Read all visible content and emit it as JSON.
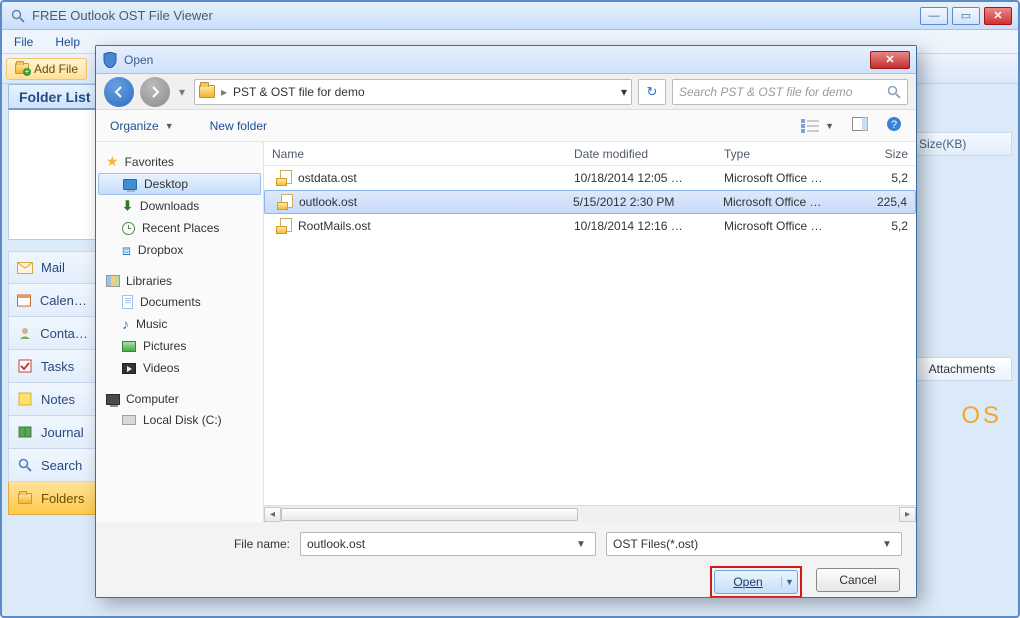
{
  "app": {
    "title": "FREE Outlook OST File Viewer",
    "menus": {
      "file": "File",
      "help": "Help"
    },
    "toolbar": {
      "add_file": "Add File"
    },
    "folder_list_header": "Folder List",
    "size_column_header": "Size(KB)",
    "attachments_tab": "Attachments",
    "os_decoration": "OS",
    "sidebar": [
      {
        "key": "mail",
        "label": "Mail",
        "icon": "mail"
      },
      {
        "key": "calendar",
        "label": "Calendar",
        "icon": "calendar"
      },
      {
        "key": "contacts",
        "label": "Contacts",
        "icon": "contacts"
      },
      {
        "key": "tasks",
        "label": "Tasks",
        "icon": "tasks"
      },
      {
        "key": "notes",
        "label": "Notes",
        "icon": "notes"
      },
      {
        "key": "journal",
        "label": "Journal",
        "icon": "journal"
      },
      {
        "key": "search",
        "label": "Search",
        "icon": "search"
      },
      {
        "key": "folders",
        "label": "Folders",
        "icon": "folder",
        "active": true
      }
    ]
  },
  "dialog": {
    "title": "Open",
    "path": {
      "folder_label": "PST & OST file for demo"
    },
    "search_placeholder": "Search PST & OST file for demo",
    "toolbar": {
      "organize": "Organize",
      "new_folder": "New folder"
    },
    "navpane": {
      "favorites": {
        "label": "Favorites",
        "items": [
          {
            "label": "Desktop",
            "selected": true
          },
          {
            "label": "Downloads"
          },
          {
            "label": "Recent Places"
          },
          {
            "label": "Dropbox"
          }
        ]
      },
      "libraries": {
        "label": "Libraries",
        "items": [
          {
            "label": "Documents"
          },
          {
            "label": "Music"
          },
          {
            "label": "Pictures"
          },
          {
            "label": "Videos"
          }
        ]
      },
      "computer": {
        "label": "Computer",
        "items": [
          {
            "label": "Local Disk (C:)"
          }
        ]
      }
    },
    "columns": {
      "name": "Name",
      "date": "Date modified",
      "type": "Type",
      "size": "Size"
    },
    "files": [
      {
        "name": "ostdata.ost",
        "date": "10/18/2014 12:05 …",
        "type": "Microsoft Office …",
        "size": "5,2"
      },
      {
        "name": "outlook.ost",
        "date": "5/15/2012 2:30 PM",
        "type": "Microsoft Office …",
        "size": "225,4",
        "selected": true
      },
      {
        "name": "RootMails.ost",
        "date": "10/18/2014 12:16 …",
        "type": "Microsoft Office …",
        "size": "5,2"
      }
    ],
    "file_name": {
      "label": "File name:",
      "value": "outlook.ost"
    },
    "filter": {
      "value": "OST Files(*.ost)"
    },
    "buttons": {
      "open": "Open",
      "cancel": "Cancel"
    }
  }
}
